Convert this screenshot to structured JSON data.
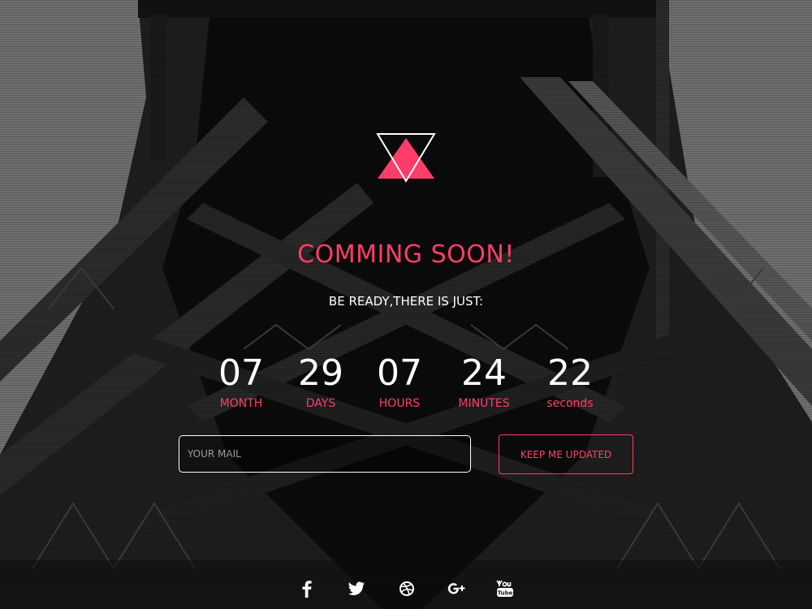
{
  "colors": {
    "accent": "#ff3d6a",
    "text": "#ffffff",
    "background": "#111111"
  },
  "logo": {
    "icon": "triangle-logo-icon"
  },
  "hero": {
    "headline": "COMMING SOON!",
    "subheadline": "BE READY,THERE IS JUST:"
  },
  "countdown": [
    {
      "value": "07",
      "label": "MONTH"
    },
    {
      "value": "29",
      "label": "DAYS"
    },
    {
      "value": "07",
      "label": "HOURS"
    },
    {
      "value": "24",
      "label": "MINUTES"
    },
    {
      "value": "22",
      "label": "seconds"
    }
  ],
  "subscribe": {
    "placeholder": "YOUR MAIL",
    "value": "",
    "button_label": "KEEP ME UPDATED"
  },
  "social": [
    {
      "icon": "facebook-icon"
    },
    {
      "icon": "twitter-icon"
    },
    {
      "icon": "dribbble-icon"
    },
    {
      "icon": "google-plus-icon"
    },
    {
      "icon": "youtube-icon"
    }
  ]
}
